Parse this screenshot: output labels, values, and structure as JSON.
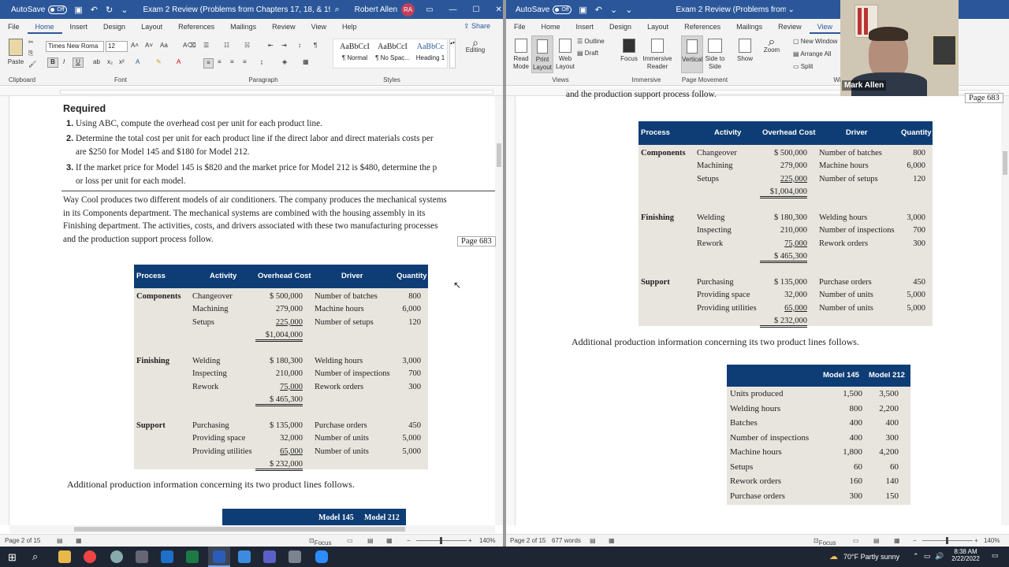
{
  "left_window": {
    "autosave_label": "AutoSave",
    "autosave_state": "Off",
    "title": "Exam 2 Review (Problems from Chapters 17, 18, & 19) - 2 -...",
    "user": "Robert Allen",
    "user_initials": "RA",
    "tabs": [
      "File",
      "Home",
      "Insert",
      "Design",
      "Layout",
      "References",
      "Mailings",
      "Review",
      "View",
      "Help"
    ],
    "active_tab": "Home",
    "share_label": "Share",
    "clipboard": {
      "paste": "Paste",
      "group": "Clipboard"
    },
    "font": {
      "family": "Times New Roma",
      "size": "12",
      "group": "Font"
    },
    "paragraph_group": "Paragraph",
    "styles": [
      {
        "preview": "AaBbCcI",
        "name": "¶ Normal"
      },
      {
        "preview": "AaBbCcI",
        "name": "¶ No Spac..."
      },
      {
        "preview": "AaBbCc",
        "name": "Heading 1"
      }
    ],
    "styles_group": "Styles",
    "editing_label": "Editing",
    "status": {
      "page": "Page 2 of 15",
      "focus": "Focus",
      "zoom": "140%"
    }
  },
  "right_window": {
    "autosave_label": "AutoSave",
    "autosave_state": "Off",
    "title": "Exam 2 Review (Problems from C...",
    "tabs": [
      "File",
      "Home",
      "Insert",
      "Design",
      "Layout",
      "References",
      "Mailings",
      "Review",
      "View",
      "He"
    ],
    "active_tab": "View",
    "views": {
      "read_mode": "Read Mode",
      "print_layout": "Print Layout",
      "web_layout": "Web Layout",
      "outline": "Outline",
      "draft": "Draft",
      "group": "Views"
    },
    "immersive": {
      "focus": "Focus",
      "reader": "Immersive Reader",
      "group": "Immersive"
    },
    "page_movement": {
      "vertical": "Vertical",
      "side": "Side to Side",
      "group": "Page Movement"
    },
    "show": "Show",
    "zoom": "Zoom",
    "window": {
      "new": "New Window",
      "arrange": "Arrange All",
      "split": "Split",
      "group": "Wi"
    },
    "webcam_name": "Mark Allen",
    "status": {
      "page": "Page 2 of 15",
      "words": "677 words",
      "focus": "Focus",
      "zoom": "140%"
    }
  },
  "doc_left": {
    "required_heading": "Required",
    "requirements": [
      {
        "n": "1.",
        "lines": [
          "Using ABC, compute the overhead cost per unit for each product line."
        ]
      },
      {
        "n": "2.",
        "lines": [
          "Determine the total cost per unit for each product line if the direct labor and direct materials costs per",
          "are $250 for Model 145 and $180 for Model 212."
        ]
      },
      {
        "n": "3.",
        "lines": [
          "If the market price for Model 145 is $820 and the market price for Model 212 is $480, determine the p",
          "or loss per unit for each model."
        ]
      }
    ],
    "intro_lines": [
      "Way Cool produces two different models of air conditioners. The company produces the mechanical systems",
      "in its Components department. The mechanical systems are combined with the housing assembly in its",
      "Finishing department. The activities, costs, and drivers associated with these two manufacturing processes",
      "and the production support process follow."
    ],
    "page_ref": "Page 683",
    "additional_info": "Additional production information concerning its two product lines follows.",
    "partial_headers": [
      "Model 145",
      "Model 212"
    ]
  },
  "doc_right": {
    "cut_line": "and the production support process follow.",
    "page_ref": "Page 683",
    "additional_info": "Additional production information concerning its two product lines follows."
  },
  "overhead_table": {
    "headers": [
      "Process",
      "Activity",
      "Overhead Cost",
      "Driver",
      "Quantity"
    ],
    "groups": [
      {
        "process": "Components",
        "rows": [
          {
            "activity": "Changeover",
            "cost": "$  500,000",
            "driver": "Number of batches",
            "qty": "800"
          },
          {
            "activity": "Machining",
            "cost": "279,000",
            "driver": "Machine hours",
            "qty": "6,000"
          },
          {
            "activity": "Setups",
            "cost": "225,000",
            "driver": "Number of setups",
            "qty": "120"
          }
        ],
        "total": "$1,004,000"
      },
      {
        "process": "Finishing",
        "rows": [
          {
            "activity": "Welding",
            "cost": "$  180,300",
            "driver": "Welding hours",
            "qty": "3,000"
          },
          {
            "activity": "Inspecting",
            "cost": "210,000",
            "driver": "Number of inspections",
            "qty": "700"
          },
          {
            "activity": "Rework",
            "cost": "75,000",
            "driver": "Rework orders",
            "qty": "300"
          }
        ],
        "total": "$  465,300"
      },
      {
        "process": "Support",
        "rows": [
          {
            "activity": "Purchasing",
            "cost": "$  135,000",
            "driver": "Purchase orders",
            "qty": "450"
          },
          {
            "activity": "Providing space",
            "cost": "32,000",
            "driver": "Number of units",
            "qty": "5,000"
          },
          {
            "activity": "Providing utilities",
            "cost": "65,000",
            "driver": "Number of units",
            "qty": "5,000"
          }
        ],
        "total": "$  232,000"
      }
    ]
  },
  "model_table": {
    "headers": [
      "Model 145",
      "Model 212"
    ],
    "rows": [
      {
        "label": "Units produced",
        "m145": "1,500",
        "m212": "3,500"
      },
      {
        "label": "Welding hours",
        "m145": "800",
        "m212": "2,200"
      },
      {
        "label": "Batches",
        "m145": "400",
        "m212": "400"
      },
      {
        "label": "Number of inspections",
        "m145": "400",
        "m212": "300"
      },
      {
        "label": "Machine hours",
        "m145": "1,800",
        "m212": "4,200"
      },
      {
        "label": "Setups",
        "m145": "60",
        "m212": "60"
      },
      {
        "label": "Rework orders",
        "m145": "160",
        "m212": "140"
      },
      {
        "label": "Purchase orders",
        "m145": "300",
        "m212": "150"
      }
    ]
  },
  "taskbar": {
    "weather": "70°F  Partly sunny",
    "time": "8:38 AM",
    "date": "2/22/2022"
  }
}
